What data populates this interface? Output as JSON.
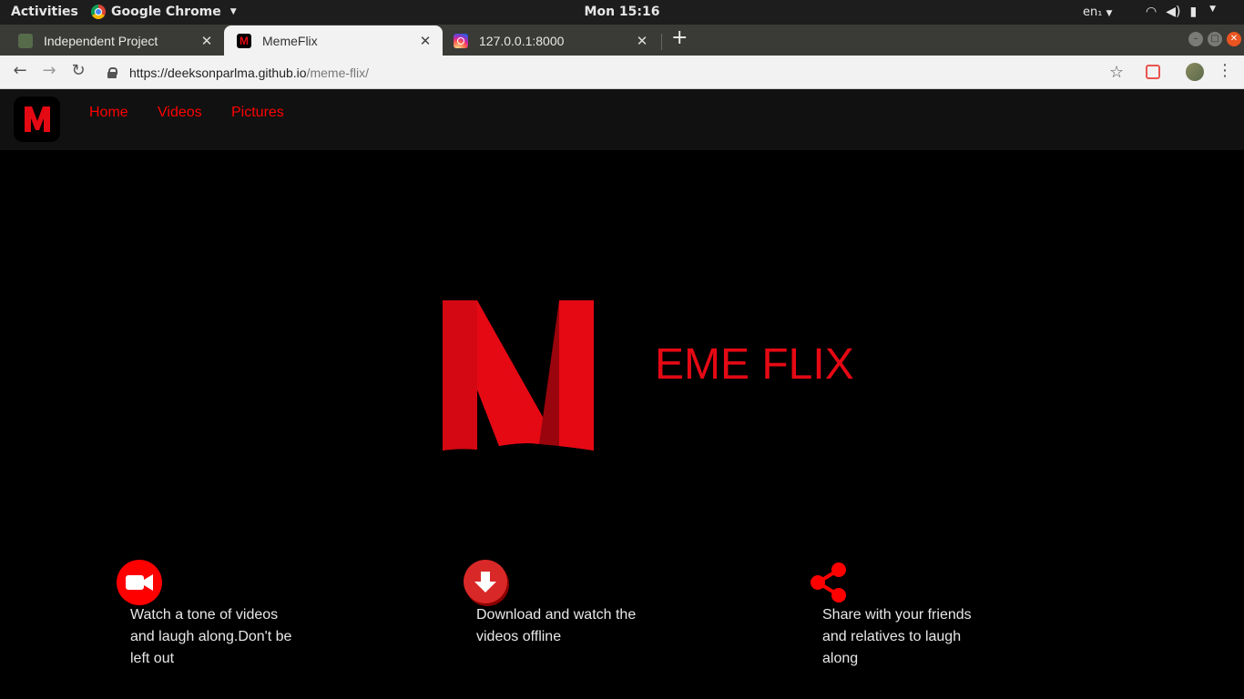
{
  "system_bar": {
    "activities": "Activities",
    "app_name": "Google Chrome",
    "clock": "Mon 15:16",
    "language": "en₁"
  },
  "browser": {
    "tabs": [
      {
        "title": "Independent Project",
        "active": false
      },
      {
        "title": "MemeFlix",
        "active": true
      },
      {
        "title": "127.0.0.1:8000",
        "active": false
      }
    ],
    "url_host": "https://deeksonparlma.github.io",
    "url_path": "/meme-flix/"
  },
  "site": {
    "nav_logo_letter": "M",
    "nav_links": [
      "Home",
      "Videos",
      "Pictures"
    ],
    "brand_title": "EME FLIX",
    "accent_color": "#e50914",
    "features": [
      {
        "icon": "video-camera-icon",
        "text": "Watch a tone of videos and laugh along.Don't be left out"
      },
      {
        "icon": "download-icon",
        "text": "Download and watch the videos offline"
      },
      {
        "icon": "share-icon",
        "text": "Share with your friends and relatives to laugh along"
      }
    ]
  }
}
